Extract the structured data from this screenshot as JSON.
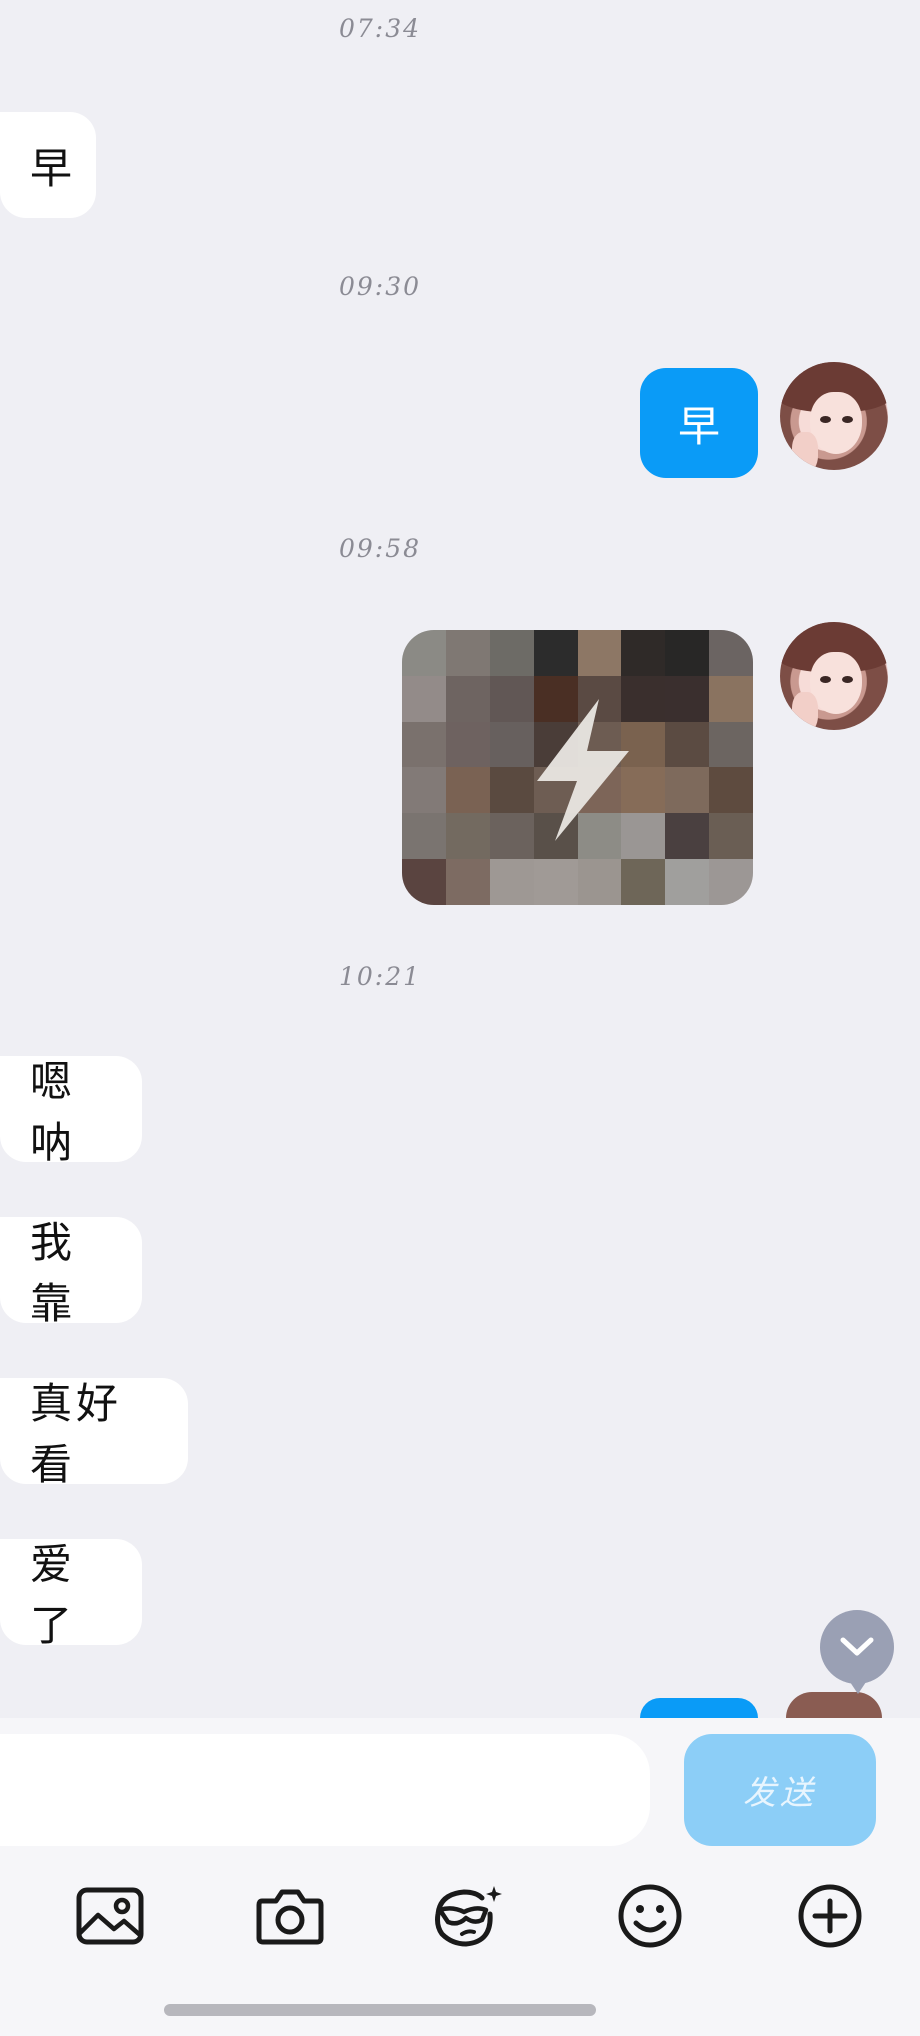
{
  "timestamps": [
    "07:34",
    "09:30",
    "09:58",
    "10:21"
  ],
  "messages": {
    "m1": "早",
    "m2_sent": "早",
    "m4": "嗯呐",
    "m5": "我靠",
    "m6": "真好看",
    "m7": "爱了"
  },
  "composer": {
    "input_value": "",
    "send_label": "发送"
  },
  "toolbar": {
    "icons": [
      "image-icon",
      "camera-icon",
      "sticker-face-icon",
      "emoji-icon",
      "plus-icon"
    ]
  },
  "colors": {
    "background": "#efeff4",
    "sent_bubble": "#0a9bf7",
    "send_button_disabled": "#8ccef7",
    "received_bubble": "#ffffff"
  }
}
